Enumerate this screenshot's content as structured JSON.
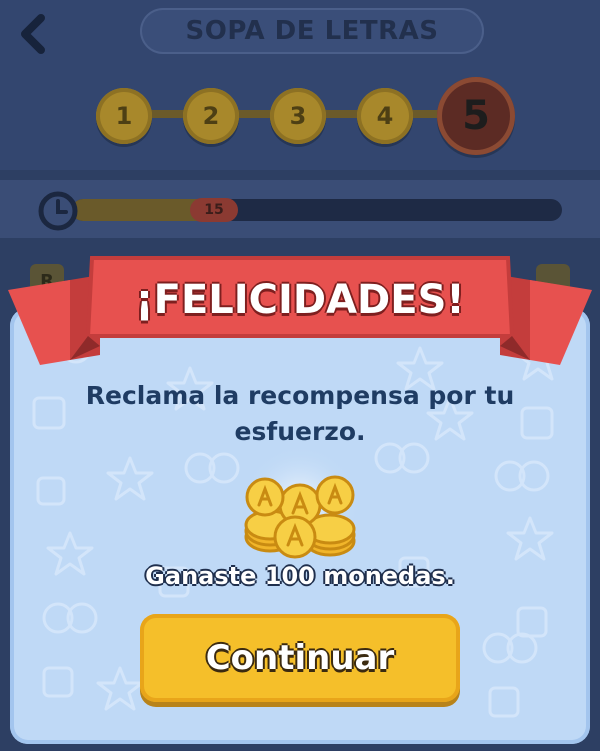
{
  "header": {
    "title": "SOPA DE LETRAS",
    "levels": [
      {
        "label": "1",
        "state": "done"
      },
      {
        "label": "2",
        "state": "done"
      },
      {
        "label": "3",
        "state": "done"
      },
      {
        "label": "4",
        "state": "done"
      },
      {
        "label": "5",
        "state": "current"
      }
    ]
  },
  "timer": {
    "value": "15",
    "progress": 0.3
  },
  "board_peek": [
    "R"
  ],
  "modal": {
    "banner_title": "¡FELICIDADES!",
    "message": "Reclama la recompensa por tu esfuerzo.",
    "reward_text": "Ganaste 100 monedas.",
    "continue_label": "Continuar"
  },
  "colors": {
    "background": "#2d3f63",
    "banner": "#e7514f",
    "modal": "#bfd9f6",
    "button": "#f5bf2a",
    "coin": "#f4c02f"
  },
  "icons": [
    "back-arrow-icon",
    "clock-icon",
    "coin-stack-icon"
  ]
}
